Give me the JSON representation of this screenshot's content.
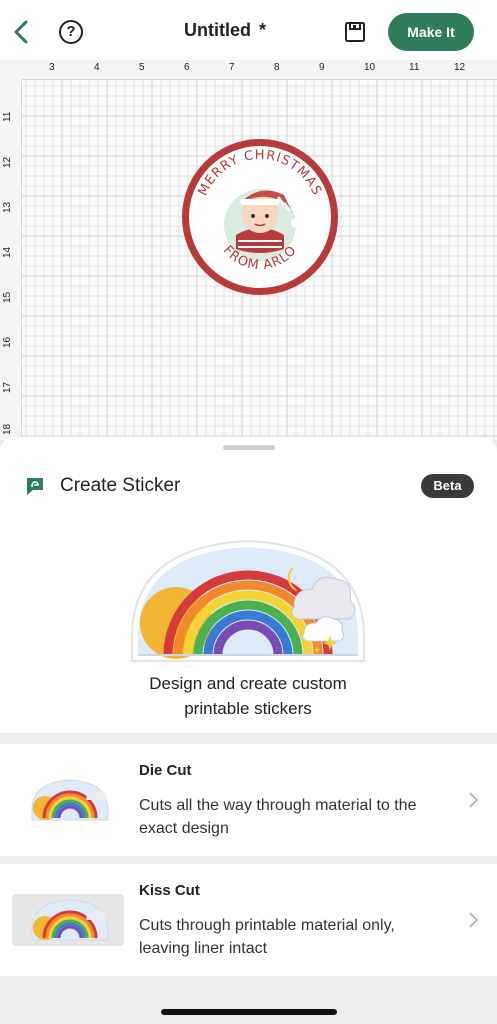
{
  "header": {
    "title": "Untitled",
    "unsaved_mark": "*",
    "help_glyph": "?",
    "make_it_label": "Make It",
    "icons": [
      "chevron-left-icon",
      "help-circle-icon",
      "save-icon"
    ]
  },
  "canvas": {
    "ruler_top": [
      "3",
      "4",
      "5",
      "6",
      "7",
      "8",
      "9",
      "10",
      "11",
      "12"
    ],
    "ruler_left": [
      "11",
      "12",
      "13",
      "14",
      "15",
      "16",
      "17",
      "18"
    ],
    "design_text_top": "MERRY CHRISTMAS",
    "design_text_bottom": "FROM ARLO"
  },
  "sticker_panel": {
    "title": "Create Sticker",
    "badge": "Beta",
    "description_line1": "Design and create custom",
    "description_line2": "printable stickers"
  },
  "options": [
    {
      "title": "Die Cut",
      "description": "Cuts all the way through material to the exact design"
    },
    {
      "title": "Kiss Cut",
      "description": "Cuts through printable material only, leaving liner intact"
    }
  ],
  "colors": {
    "accent_green": "#2f7d5a",
    "badge_dark": "#3a3a3a",
    "design_red": "#b83a3a"
  }
}
